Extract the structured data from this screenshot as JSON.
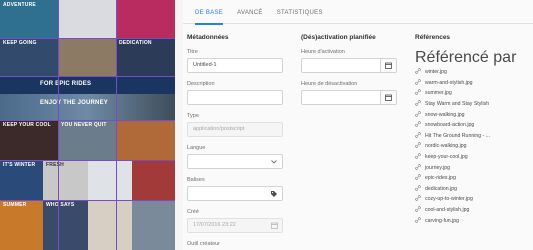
{
  "preview": {
    "tiles": [
      {
        "text": "Adventure",
        "color": "#2f6f8f"
      },
      {
        "text": "",
        "color": "#d9dbe0"
      },
      {
        "text": "",
        "color": "#b82c5f"
      },
      {
        "text": "Keep Going",
        "color": "#324a6c"
      },
      {
        "text": "",
        "color": "#8c7a64"
      },
      {
        "text": "",
        "color": "#c7d6e6"
      },
      {
        "text": "",
        "color": "#2b6fa8"
      },
      {
        "text": "",
        "color": "#5a6a3a"
      },
      {
        "text": "Dedication",
        "color": "#2c3c58"
      },
      {
        "text": "For Epic Rides",
        "color": "#1a3560"
      },
      {
        "text": "Enjoy the Journey",
        "color": "#4a6a8a"
      },
      {
        "text": "Keep Your Cool",
        "color": "#3c2a2a"
      },
      {
        "text": "You Never Quit",
        "color": "#6b7c8a"
      },
      {
        "text": "",
        "color": "#b06a3a"
      },
      {
        "text": "",
        "color": "#2e2e3e"
      },
      {
        "text": "Fresh",
        "color": "#c8c8c8"
      },
      {
        "text": "",
        "color": "#d4d8dc"
      },
      {
        "text": "It's Winter",
        "color": "#2a4a7a"
      },
      {
        "text": "",
        "color": "#dfe3e7"
      },
      {
        "text": "",
        "color": "#a33a3a"
      },
      {
        "text": "Who Says",
        "color": "#3a4a6a"
      },
      {
        "text": "",
        "color": "#d8cfc4"
      },
      {
        "text": "Summer",
        "color": "#c87a2a"
      },
      {
        "text": "",
        "color": "#7a8a9a"
      }
    ]
  },
  "tabs": [
    {
      "label": "DE BASE",
      "active": true
    },
    {
      "label": "AVANCÉ",
      "active": false
    },
    {
      "label": "STATISTIQUES",
      "active": false
    }
  ],
  "metadata": {
    "heading": "Métadonnées",
    "title_label": "Titre",
    "title_value": "Untitled-1",
    "description_label": "Description",
    "description_value": "",
    "type_label": "Type",
    "type_value": "application/postscript",
    "language_label": "Langue",
    "language_value": "",
    "tags_label": "Balises",
    "tags_value": "",
    "created_label": "Créé",
    "created_value": "17/07/2016 23:22",
    "creator_tool_label": "Outil créateur"
  },
  "schedule": {
    "heading": "(Dés)activation planifiée",
    "on_label": "Heure d'activation",
    "on_value": "",
    "off_label": "Heure de désactivation",
    "off_value": ""
  },
  "references": {
    "heading": "Références",
    "sub_label": "Référencé par",
    "items": [
      "winter.jpg",
      "warm-and-stylish.jpg",
      "summer.jpg",
      "Stay Warm and Stay Stylish",
      "snow-walking.jpg",
      "snowboard-action.jpg",
      "Hit The Ground Running - ...",
      "nordic-walking.jpg",
      "keep-your-cool.jpg",
      "journey.jpg",
      "epic-rides.jpg",
      "dedication.jpg",
      "cozy-up-to-winter.jpg",
      "cool-and-stylish.jpg",
      "carving-fun.jpg"
    ]
  },
  "colors": {
    "accent": "#2680eb",
    "tile_border": "#7a4cc9"
  }
}
